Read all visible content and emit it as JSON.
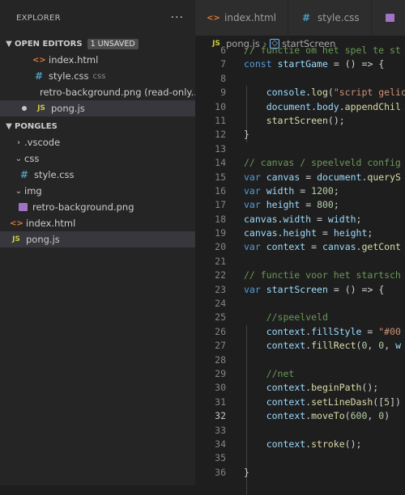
{
  "sidebar": {
    "title": "EXPLORER",
    "more": "···",
    "open_editors": {
      "label": "OPEN EDITORS",
      "badge": "1 UNSAVED",
      "items": [
        {
          "name": "index.html",
          "hint": ""
        },
        {
          "name": "style.css",
          "hint": "css"
        },
        {
          "name": "retro-background.png (read-only...",
          "hint": ""
        },
        {
          "name": "pong.js",
          "hint": ""
        }
      ]
    },
    "project": {
      "label": "PONGLES",
      "items": [
        ".vscode",
        "css",
        "style.css",
        "img",
        "retro-background.png",
        "index.html",
        "pong.js"
      ]
    }
  },
  "tabs": [
    "index.html",
    "style.css",
    ""
  ],
  "breadcrumb": {
    "file": "pong.js",
    "symbol": "startScreen"
  },
  "code": {
    "line_numbers": [
      "6",
      "7",
      "8",
      "9",
      "10",
      "11",
      "12",
      "13",
      "14",
      "15",
      "16",
      "17",
      "18",
      "19",
      "20",
      "21",
      "22",
      "23",
      "24",
      "25",
      "26",
      "27",
      "28",
      "29",
      "30",
      "31",
      "32",
      "33",
      "34",
      "35",
      "36"
    ],
    "lines": [
      "// functie om het spel te st",
      "const startGame = () => {",
      "",
      "    console.log(\"script gelic",
      "    document.body.appendChil",
      "    startScreen();",
      "}",
      "",
      "// canvas / speelveld config",
      "var canvas = document.queryS",
      "var width = 1200;",
      "var height = 800;",
      "canvas.width = width;",
      "canvas.height = height;",
      "var context = canvas.getCont",
      "",
      "// functie voor het startsch",
      "var startScreen = () => {",
      "",
      "    //speelveld",
      "    context.fillStyle = \"#00",
      "    context.fillRect(0, 0, w",
      "",
      "    //net",
      "    context.beginPath();",
      "    context.setLineDash([5])",
      "    context.moveTo(600, 0)",
      "",
      "    context.stroke();",
      "",
      "}"
    ]
  },
  "colors": {
    "keyword": "#569cd6",
    "function": "#dcdcaa",
    "variable": "#9cdcfe",
    "string": "#ce9178",
    "number": "#b5cea8",
    "comment": "#6a9955"
  }
}
